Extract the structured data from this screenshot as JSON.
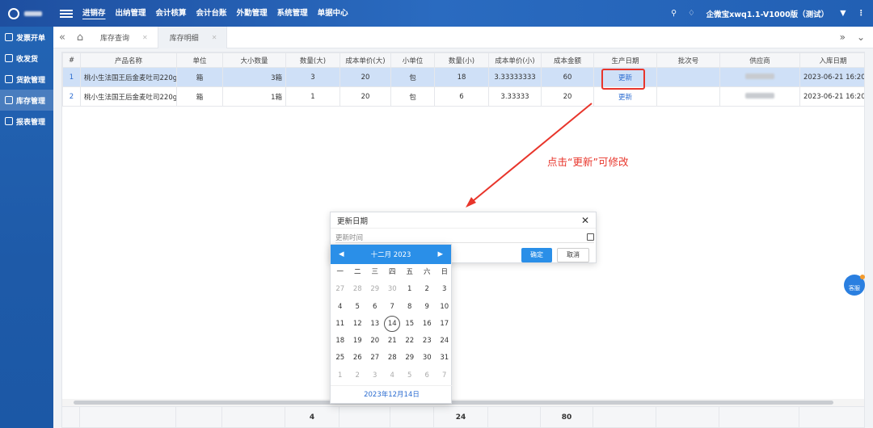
{
  "topbar": {
    "nav": [
      "进销存",
      "出纳管理",
      "会计核算",
      "会计台账",
      "外勤管理",
      "系统管理",
      "单据中心"
    ],
    "active_index": 0,
    "company": "企微宝xwq1.1-V1000版（测试）"
  },
  "sidebar": {
    "items": [
      {
        "label": "发票开单"
      },
      {
        "label": "收发货"
      },
      {
        "label": "货款管理"
      },
      {
        "label": "库存管理",
        "active": true
      },
      {
        "label": "报表管理"
      }
    ]
  },
  "tabs": [
    {
      "label": "库存查询"
    },
    {
      "label": "库存明细",
      "active": true
    }
  ],
  "table": {
    "headers": [
      "#",
      "产品名称",
      "单位",
      "大小数量",
      "数量(大)",
      "成本单价(大)",
      "小单位",
      "数量(小)",
      "成本单价(小)",
      "成本金额",
      "生产日期",
      "批次号",
      "供应商",
      "入库日期"
    ],
    "rows": [
      [
        "1",
        "桃小生法国王后金麦吐司220g",
        "箱",
        "3箱",
        "3",
        "20",
        "包",
        "18",
        "3.33333333",
        "60",
        "更新",
        "",
        "",
        "2023-06-21 16:20"
      ],
      [
        "2",
        "桃小生法国王后金麦吐司220g",
        "箱",
        "1箱",
        "1",
        "20",
        "包",
        "6",
        "3.33333",
        "20",
        "更新",
        "",
        "",
        "2023-06-21 16:20"
      ]
    ],
    "footer_totals": {
      "qty_big": "4",
      "qty_small": "24",
      "cost_amount": "80"
    }
  },
  "annotation": "点击“更新”可修改",
  "dialog": {
    "title": "更新日期",
    "placeholder": "更新时间",
    "ok": "确定",
    "cancel": "取消"
  },
  "calendar": {
    "month_label": "十二月 2023",
    "weekdays": [
      "一",
      "二",
      "三",
      "四",
      "五",
      "六",
      "日"
    ],
    "days": [
      "27",
      "28",
      "29",
      "30",
      "1",
      "2",
      "3",
      "4",
      "5",
      "6",
      "7",
      "8",
      "9",
      "10",
      "11",
      "12",
      "13",
      "14",
      "15",
      "16",
      "17",
      "18",
      "19",
      "20",
      "21",
      "22",
      "23",
      "24",
      "25",
      "26",
      "27",
      "28",
      "29",
      "30",
      "31",
      "1",
      "2",
      "3",
      "4",
      "5",
      "6",
      "7"
    ],
    "today": "14",
    "footer": "2023年12月14日"
  },
  "kefu": "客服",
  "colors": {
    "accent": "#2a8fe8",
    "annotation": "#e8352b",
    "nav_bg": "#1e4fa0"
  }
}
